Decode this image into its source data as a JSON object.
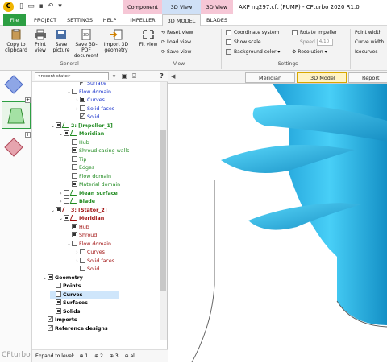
{
  "app": {
    "window_title": "AXP nq297.cft (PUMP) - CFturbo 2020 R1.0",
    "context_tabs": [
      {
        "label": "Component",
        "color": "#f6c7d6"
      },
      {
        "label": "3D View",
        "color": "#cfe0f6"
      },
      {
        "label": "3D View",
        "color": "#f6c7d6"
      }
    ]
  },
  "tabs": [
    "File",
    "PROJECT",
    "SETTINGS",
    "HELP",
    "IMPELLER",
    "3D MODEL",
    "BLADES"
  ],
  "active_tab": "3D MODEL",
  "ribbon": {
    "general": {
      "label": "General",
      "buttons": [
        "Copy to clipboard",
        "Print view",
        "Save picture",
        "Save 3D-PDF document",
        "Import 3D geometry"
      ]
    },
    "view": {
      "label": "View",
      "fit": "Fit view",
      "reset": "Reset view",
      "load": "Load view",
      "save": "Save view"
    },
    "settings": {
      "label": "Settings",
      "coord": "Coordinate system",
      "scale": "Show scale",
      "background": "Background color",
      "rotate": "Rotate impeller",
      "speed_label": "Speed",
      "speed_value": "4/10",
      "resolution": "Resolution",
      "point_width": "Point width",
      "curve_width": "Curve width",
      "isocurves": "Isocurves"
    }
  },
  "tree": {
    "recent_state": "<recent state>",
    "nodes": [
      {
        "text": "Surface",
        "indent": 3,
        "cb": "tick",
        "color": "blue",
        "bold": false,
        "exp": ""
      },
      {
        "text": "Flow domain",
        "indent": 2,
        "cb": "empty",
        "color": "blue",
        "bold": false,
        "exp": "-"
      },
      {
        "text": "Curves",
        "indent": 3,
        "cb": "full",
        "color": "blue",
        "bold": false,
        "exp": "+"
      },
      {
        "text": "Solid faces",
        "indent": 3,
        "cb": "empty",
        "color": "blue",
        "bold": false,
        "exp": "+"
      },
      {
        "text": "Solid",
        "indent": 3,
        "cb": "tick",
        "color": "blue",
        "bold": false,
        "exp": ""
      },
      {
        "text": "2: [Impeller_1]",
        "indent": 0,
        "cb": "full",
        "color": "green",
        "bold": true,
        "exp": "-"
      },
      {
        "text": "Meridian",
        "indent": 1,
        "cb": "full",
        "color": "green",
        "bold": true,
        "exp": "-"
      },
      {
        "text": "Hub",
        "indent": 2,
        "cb": "empty",
        "color": "green",
        "bold": false,
        "exp": ""
      },
      {
        "text": "Shroud casing walls",
        "indent": 2,
        "cb": "full",
        "color": "green",
        "bold": false,
        "exp": ""
      },
      {
        "text": "Tip",
        "indent": 2,
        "cb": "empty",
        "color": "green",
        "bold": false,
        "exp": ""
      },
      {
        "text": "Edges",
        "indent": 2,
        "cb": "empty",
        "color": "green",
        "bold": false,
        "exp": ""
      },
      {
        "text": "Flow domain",
        "indent": 2,
        "cb": "empty",
        "color": "green",
        "bold": false,
        "exp": ""
      },
      {
        "text": "Material domain",
        "indent": 2,
        "cb": "full",
        "color": "green",
        "bold": false,
        "exp": ""
      },
      {
        "text": "Mean surface",
        "indent": 1,
        "cb": "empty",
        "color": "green",
        "bold": true,
        "exp": "+"
      },
      {
        "text": "Blade",
        "indent": 1,
        "cb": "empty",
        "color": "green",
        "bold": true,
        "exp": "+"
      },
      {
        "text": "3: [Stator_2]",
        "indent": 0,
        "cb": "full",
        "color": "red",
        "bold": true,
        "exp": "-"
      },
      {
        "text": "Meridian",
        "indent": 1,
        "cb": "full",
        "color": "red",
        "bold": true,
        "exp": "-"
      },
      {
        "text": "Hub",
        "indent": 2,
        "cb": "full",
        "color": "red",
        "bold": false,
        "exp": ""
      },
      {
        "text": "Shroud",
        "indent": 2,
        "cb": "full",
        "color": "red",
        "bold": false,
        "exp": ""
      },
      {
        "text": "Flow domain",
        "indent": 2,
        "cb": "empty",
        "color": "red",
        "bold": false,
        "exp": "-"
      },
      {
        "text": "Curves",
        "indent": 3,
        "cb": "empty",
        "color": "red",
        "bold": false,
        "exp": "+"
      },
      {
        "text": "Solid faces",
        "indent": 3,
        "cb": "empty",
        "color": "red",
        "bold": false,
        "exp": "+"
      },
      {
        "text": "Solid",
        "indent": 3,
        "cb": "empty",
        "color": "red",
        "bold": false,
        "exp": ""
      },
      {
        "text": "Geometry",
        "indent": -1,
        "cb": "full",
        "color": "black",
        "bold": true,
        "exp": "-"
      },
      {
        "text": "Points",
        "indent": 0,
        "cb": "empty",
        "color": "black",
        "bold": true,
        "exp": ""
      },
      {
        "text": "Curves",
        "indent": 0,
        "cb": "empty",
        "color": "black",
        "bold": true,
        "exp": "",
        "selected": true
      },
      {
        "text": "Surfaces",
        "indent": 0,
        "cb": "full",
        "color": "black",
        "bold": true,
        "exp": ""
      },
      {
        "text": "Solids",
        "indent": 0,
        "cb": "full",
        "color": "black",
        "bold": true,
        "exp": ""
      },
      {
        "text": "Imports",
        "indent": -1,
        "cb": "tick",
        "color": "black",
        "bold": true,
        "exp": ""
      },
      {
        "text": "Reference designs",
        "indent": -1,
        "cb": "tick",
        "color": "black",
        "bold": true,
        "exp": ""
      }
    ],
    "expand_label": "Expand to level:",
    "expand_levels": [
      "1",
      "2",
      "3",
      "all"
    ]
  },
  "viewport": {
    "tabs": [
      "Meridian",
      "3D Model",
      "Report"
    ],
    "active": "3D Model",
    "model_color": "#27b5ec"
  },
  "watermark": "CFturbo"
}
